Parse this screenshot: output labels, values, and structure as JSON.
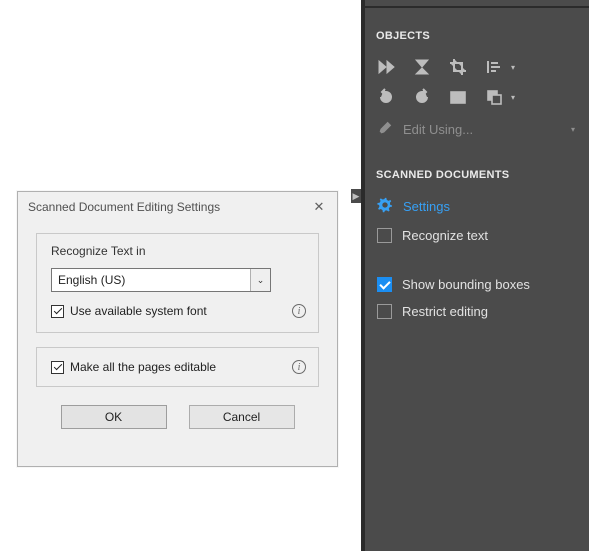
{
  "panel": {
    "objects_header": "OBJECTS",
    "scanned_header": "SCANNED DOCUMENTS",
    "edit_using": "Edit Using...",
    "settings": "Settings",
    "recognize_text": "Recognize text",
    "show_bounding": "Show bounding boxes",
    "restrict_editing": "Restrict editing",
    "checks": {
      "recognize_text": false,
      "show_bounding": true,
      "restrict_editing": false
    }
  },
  "dialog": {
    "title": "Scanned Document Editing Settings",
    "recognize_label": "Recognize Text in",
    "language": "English (US)",
    "use_system_font": "Use available system font",
    "use_system_font_checked": true,
    "make_editable": "Make all the pages editable",
    "make_editable_checked": true,
    "ok": "OK",
    "cancel": "Cancel"
  }
}
